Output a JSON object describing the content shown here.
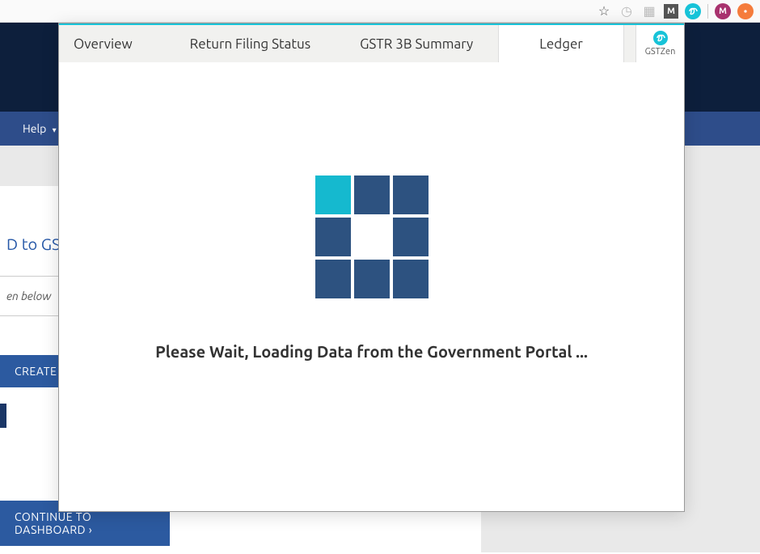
{
  "browser_toolbar": {
    "star_icon": "star-icon",
    "clock_icon": "clock-icon",
    "grid_icon": "grid-icon",
    "m_badge": "M",
    "infinity_icon": "infinity-icon",
    "profile_badge": "M",
    "exit_icon": "exit-icon"
  },
  "background": {
    "help_label": "Help",
    "partial_heading": "D to GST",
    "partial_subtext": "en below",
    "create_button": "CREATE",
    "continue_button": "CONTINUE TO DASHBOARD ›"
  },
  "popup": {
    "tabs": {
      "overview": "Overview",
      "return_filing": "Return Filing Status",
      "gstr3b": "GSTR 3B Summary",
      "ledger": "Ledger"
    },
    "brand": "GSTZen",
    "loading_message": "Please Wait, Loading Data from the Government Portal ..."
  }
}
